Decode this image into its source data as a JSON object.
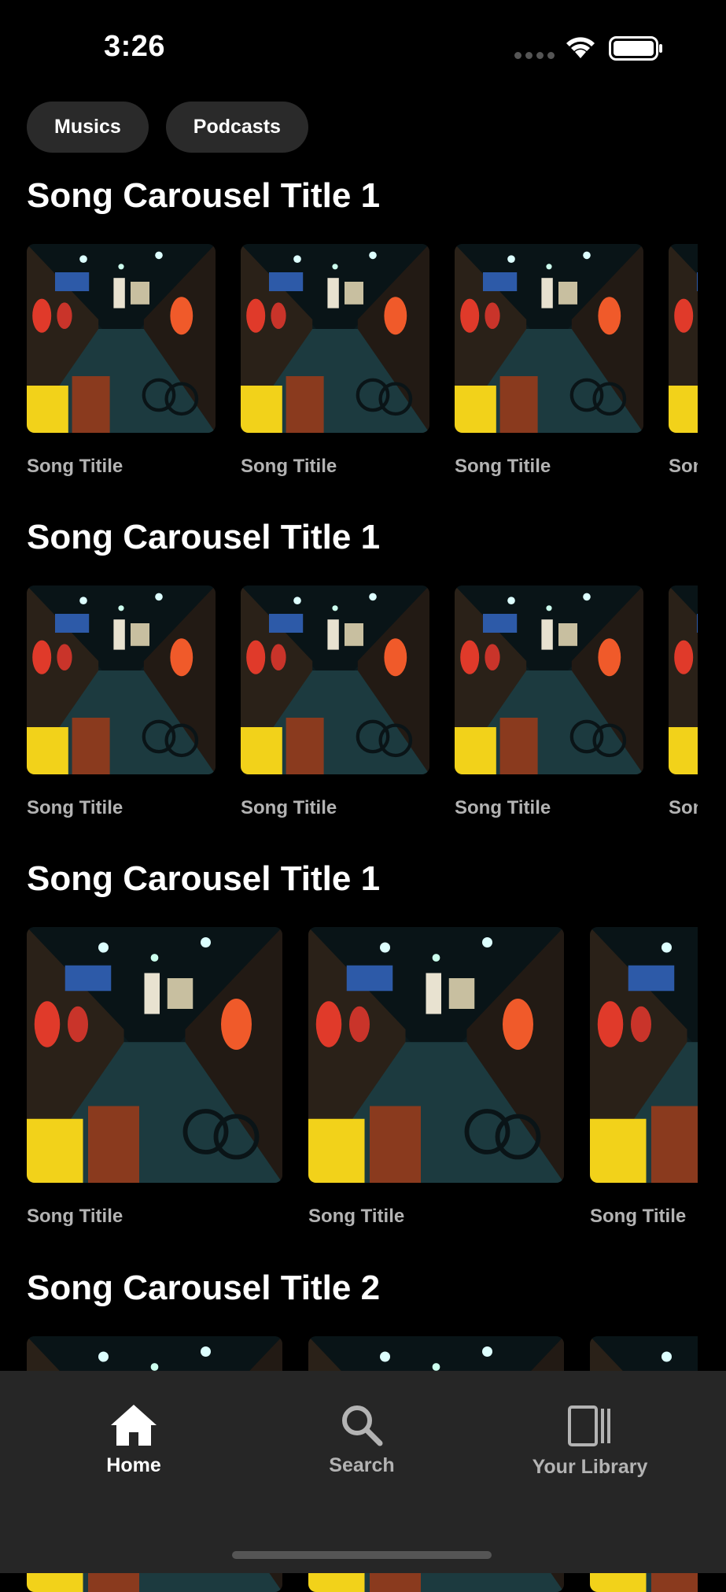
{
  "status_bar": {
    "time": "3:26"
  },
  "filters": [
    {
      "label": "Musics"
    },
    {
      "label": "Podcasts"
    }
  ],
  "sections": [
    {
      "title": "Song Carousel Title 1",
      "items": [
        "Song Titile",
        "Song Titile",
        "Song Titile",
        "Song Titile"
      ]
    },
    {
      "title": "Song Carousel Title 1",
      "items": [
        "Song Titile",
        "Song Titile",
        "Song Titile",
        "Song Titile"
      ]
    },
    {
      "title": "Song Carousel Title 1",
      "items": [
        "Song Titile",
        "Song Titile",
        "Song Titile"
      ]
    },
    {
      "title": "Song Carousel Title 2",
      "items": [
        "",
        "",
        ""
      ]
    }
  ],
  "tab_bar": {
    "tabs": [
      {
        "label": "Home",
        "icon": "home-icon",
        "active": true
      },
      {
        "label": "Search",
        "icon": "search-icon",
        "active": false
      },
      {
        "label": "Your Library",
        "icon": "library-icon",
        "active": false
      }
    ]
  },
  "colors": {
    "background": "#000000",
    "chip": "#2a2a2a",
    "tab_bar": "#262626",
    "inactive_tab": "#b3b3b3",
    "subtitle": "#b3b3b3"
  }
}
